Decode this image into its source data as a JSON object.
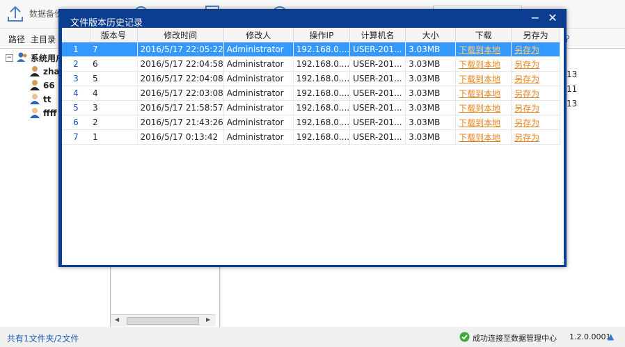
{
  "app": {
    "toolbar": {
      "backup_label": "数据备份"
    },
    "pathbar": {
      "path_label": "路径",
      "root_label": "主目录"
    },
    "tree": {
      "root": "系统用户",
      "users": [
        "zha",
        "66",
        "tt",
        "ffff"
      ]
    },
    "right_pane_values": [
      "13",
      "11",
      "13"
    ],
    "status": {
      "summary": "共有1文件夹/2文件",
      "connection": "成功连接至数据管理中心",
      "version": "1.2.0.0001"
    }
  },
  "dialog": {
    "title": "文件版本历史记录",
    "columns": [
      "版本号",
      "修改时间",
      "修改人",
      "操作IP",
      "计算机名",
      "大小",
      "下载",
      "另存为"
    ],
    "rows": [
      {
        "idx": "1",
        "version": "7",
        "time": "2016/5/17 22:05:22",
        "user": "Administrator",
        "ip": "192.168.0....",
        "pc": "USER-201...",
        "size": "3.03MB",
        "download": "下载到本地",
        "saveas": "另存为"
      },
      {
        "idx": "2",
        "version": "6",
        "time": "2016/5/17 22:04:58",
        "user": "Administrator",
        "ip": "192.168.0....",
        "pc": "USER-201...",
        "size": "3.03MB",
        "download": "下载到本地",
        "saveas": "另存为"
      },
      {
        "idx": "3",
        "version": "5",
        "time": "2016/5/17 22:04:08",
        "user": "Administrator",
        "ip": "192.168.0....",
        "pc": "USER-201...",
        "size": "3.03MB",
        "download": "下载到本地",
        "saveas": "另存为"
      },
      {
        "idx": "4",
        "version": "4",
        "time": "2016/5/17 22:03:08",
        "user": "Administrator",
        "ip": "192.168.0....",
        "pc": "USER-201...",
        "size": "3.03MB",
        "download": "下载到本地",
        "saveas": "另存为"
      },
      {
        "idx": "5",
        "version": "3",
        "time": "2016/5/17 21:58:57",
        "user": "Administrator",
        "ip": "192.168.0....",
        "pc": "USER-201...",
        "size": "3.03MB",
        "download": "下载到本地",
        "saveas": "另存为"
      },
      {
        "idx": "6",
        "version": "2",
        "time": "2016/5/17 21:43:26",
        "user": "Administrator",
        "ip": "192.168.0....",
        "pc": "USER-201...",
        "size": "3.03MB",
        "download": "下载到本地",
        "saveas": "另存为"
      },
      {
        "idx": "7",
        "version": "1",
        "time": "2016/5/17 0:13:42",
        "user": "Administrator",
        "ip": "192.168.0....",
        "pc": "USER-201...",
        "size": "3.03MB",
        "download": "下载到本地",
        "saveas": "另存为"
      }
    ],
    "selected_row_index": 0,
    "colors": {
      "titlebar": "#0b3d91",
      "selection": "#3399ff",
      "link": "#e8831c"
    }
  }
}
